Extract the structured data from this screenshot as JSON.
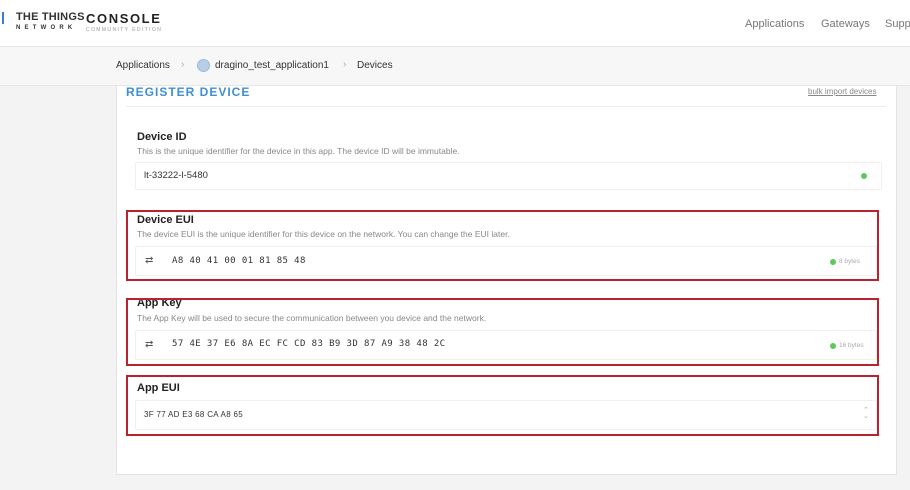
{
  "header": {
    "logo_line1": "THE THINGS",
    "logo_line2": "NETWORK",
    "console_title": "CONSOLE",
    "console_subtitle": "COMMUNITY EDITION",
    "nav": [
      "Applications",
      "Gateways",
      "Supp"
    ]
  },
  "breadcrumb": {
    "items": [
      "Applications",
      "dragino_test_application1",
      "Devices"
    ],
    "separator": "›"
  },
  "form": {
    "title": "REGISTER DEVICE",
    "bulk_import_link": "bulk import devices",
    "device_id": {
      "label": "Device ID",
      "description": "This is the unique identifier for the device in this app. The device ID will be immutable.",
      "value": "lt-33222-l-5480"
    },
    "device_eui": {
      "label": "Device EUI",
      "description": "The device EUI is the unique identifier for this device on the network. You can change the EUI later.",
      "value": "A8 40 41 00 01 81 85 48",
      "byte_count": "8 bytes"
    },
    "app_key": {
      "label": "App Key",
      "description": "The App Key will be used to secure the communication between you device and the network.",
      "value": "57 4E 37 E6 8A EC FC CD 83 B9 3D 87 A9 38 48 2C",
      "byte_count": "16 bytes"
    },
    "app_eui": {
      "label": "App EUI",
      "value": "3F 77 AD E3 68 CA A8 65"
    }
  },
  "icons": {
    "swap": "⇄",
    "stepper": "⌃⌄"
  },
  "colors": {
    "accent": "#3f8fd2",
    "highlight": "#b8232f",
    "ok": "#5cc95c"
  }
}
